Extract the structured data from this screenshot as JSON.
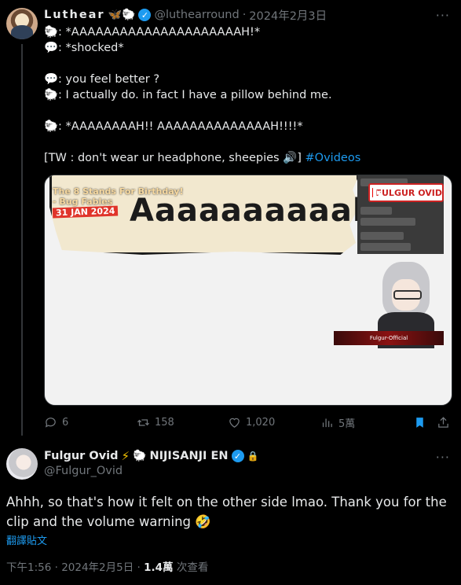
{
  "tweet1": {
    "author_name": "Luthear",
    "author_emojis": "🦋🐑",
    "handle": "@luthearround",
    "date": "2024年2月3日",
    "lines": [
      {
        "icon": "🐑",
        "text": ": *AAAAAAAAAAAAAAAAAAAAAH!*"
      },
      {
        "icon": "💬",
        "text": ": *shocked*"
      },
      {
        "gap": true
      },
      {
        "icon": "💬",
        "text": ": you feel better ?"
      },
      {
        "icon": "🐑",
        "text": ": I actually do. in fact I have a pillow behind me."
      },
      {
        "gap": true
      },
      {
        "icon": "🐑",
        "text": ": *AAAAAAAAH!! AAAAAAAAAAAAAAH!!!!*"
      },
      {
        "gap": true
      }
    ],
    "tw_line_text": "[TW : don't wear ur headphone, sheepies 🔊]",
    "hashtag": "#Ovideos",
    "media": {
      "title": "The 8 Stands For Birthday!",
      "subtitle": "- Bug Fables",
      "date": "31 JAN 2024",
      "scream": "Aaaaaaaaaah!",
      "channel": "FULGUR OVID",
      "nameplate": "Fulgur-Official"
    },
    "actions": {
      "replies": "6",
      "reposts": "158",
      "likes": "1,020",
      "views": "5萬"
    }
  },
  "tweet2": {
    "author_name": "Fulgur Ovid",
    "affiliation": "NIJISANJI EN",
    "handle": "@Fulgur_Ovid",
    "text": "Ahhh, so that's how it felt on the other side lmao. Thank you for the clip and the volume warning 🤣",
    "translate": "翻譯貼文",
    "time": "下午1:56 · 2024年2月5日 · ",
    "views_count": "1.4萬",
    "views_label": " 次查看"
  },
  "colors": {
    "background": "#000000",
    "text": "#e7e9ea",
    "muted": "#71767b",
    "accent": "#1d9bf0"
  }
}
